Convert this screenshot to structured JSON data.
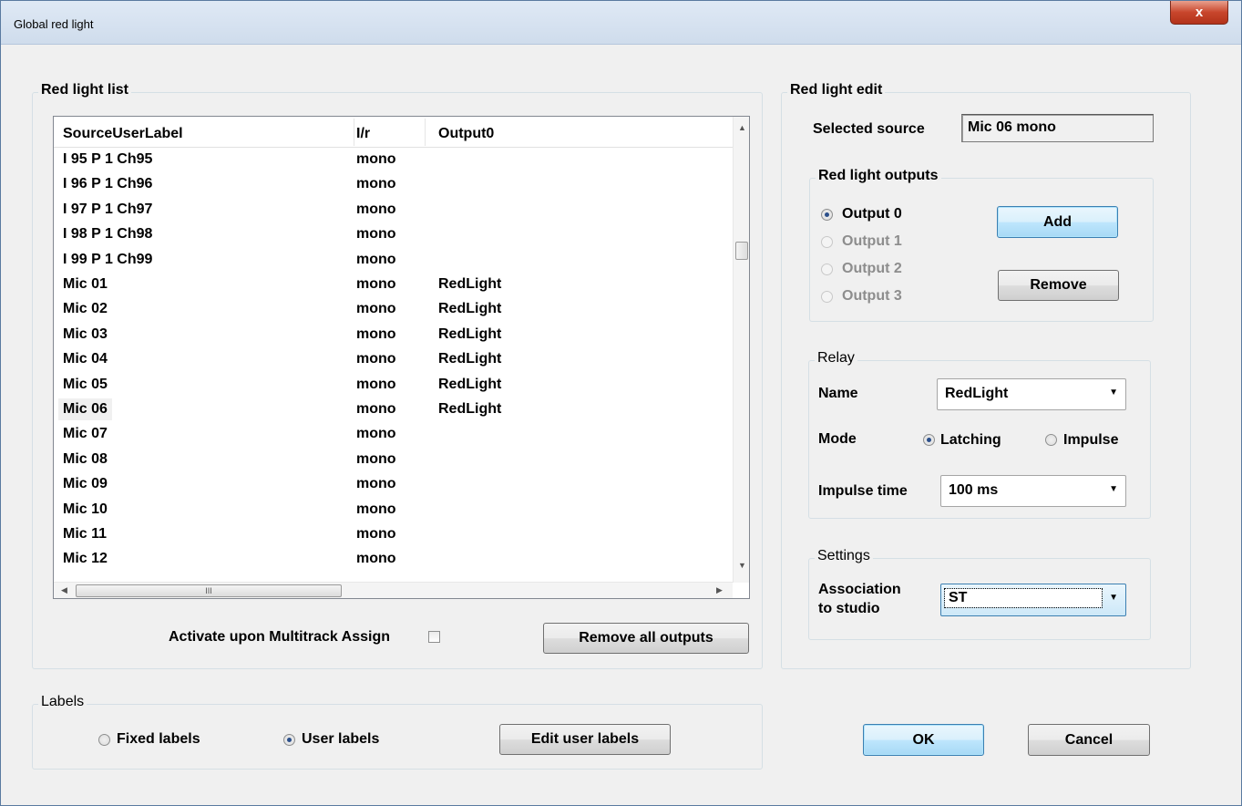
{
  "window": {
    "title": "Global red light",
    "close_label": "x"
  },
  "red_light_list": {
    "group_title": "Red light list",
    "columns": [
      "SourceUserLabel",
      "I/r",
      "Output0"
    ],
    "rows": [
      [
        "I 95 P 1 Ch95",
        "mono",
        ""
      ],
      [
        "I 96 P 1 Ch96",
        "mono",
        ""
      ],
      [
        "I 97 P 1 Ch97",
        "mono",
        ""
      ],
      [
        "I 98 P 1 Ch98",
        "mono",
        ""
      ],
      [
        "I 99 P 1 Ch99",
        "mono",
        ""
      ],
      [
        "Mic 01",
        "mono",
        "RedLight"
      ],
      [
        "Mic 02",
        "mono",
        "RedLight"
      ],
      [
        "Mic 03",
        "mono",
        "RedLight"
      ],
      [
        "Mic 04",
        "mono",
        "RedLight"
      ],
      [
        "Mic 05",
        "mono",
        "RedLight"
      ],
      [
        "Mic 06",
        "mono",
        "RedLight"
      ],
      [
        "Mic 07",
        "mono",
        ""
      ],
      [
        "Mic 08",
        "mono",
        ""
      ],
      [
        "Mic 09",
        "mono",
        ""
      ],
      [
        "Mic 10",
        "mono",
        ""
      ],
      [
        "Mic 11",
        "mono",
        ""
      ],
      [
        "Mic 12",
        "mono",
        ""
      ]
    ],
    "selected_row": 10,
    "hscroll_grip": "III",
    "activate_label": "Activate upon Multitrack Assign",
    "activate_checked": false,
    "remove_all_label": "Remove all outputs"
  },
  "red_light_edit": {
    "group_title": "Red light edit",
    "selected_source_label": "Selected source",
    "selected_source_value": "Mic 06 mono",
    "outputs": {
      "group_title": "Red light outputs",
      "items": [
        {
          "label": "Output 0",
          "selected": true,
          "enabled": true
        },
        {
          "label": "Output 1",
          "selected": false,
          "enabled": false
        },
        {
          "label": "Output 2",
          "selected": false,
          "enabled": false
        },
        {
          "label": "Output 3",
          "selected": false,
          "enabled": false
        }
      ],
      "add_label": "Add",
      "remove_label": "Remove"
    },
    "relay": {
      "group_title": "Relay",
      "name_label": "Name",
      "name_value": "RedLight",
      "mode_label": "Mode",
      "mode_latching": "Latching",
      "mode_impulse": "Impulse",
      "mode_selected": "Latching",
      "impulse_time_label": "Impulse time",
      "impulse_time_value": "100 ms"
    },
    "settings": {
      "group_title": "Settings",
      "association_label_1": "Association",
      "association_label_2": "to studio",
      "association_value": "ST"
    }
  },
  "labels": {
    "group_title": "Labels",
    "fixed_label": "Fixed labels",
    "user_label": "User labels",
    "selected": "User labels",
    "edit_label": "Edit user labels"
  },
  "footer": {
    "ok_label": "OK",
    "cancel_label": "Cancel"
  }
}
